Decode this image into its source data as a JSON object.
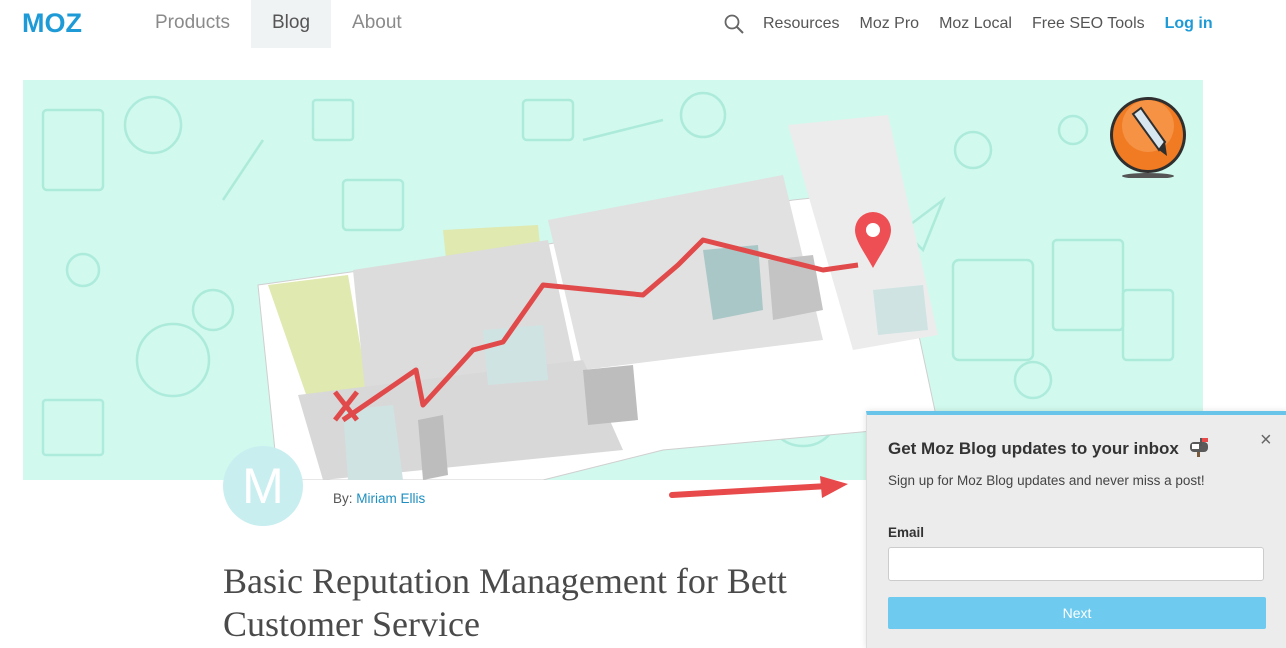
{
  "nav": {
    "logo_text": "MOZ",
    "left_items": [
      "Products",
      "Blog",
      "About"
    ],
    "right_items": [
      "Resources",
      "Moz Pro",
      "Moz Local",
      "Free SEO Tools"
    ],
    "login_label": "Log in"
  },
  "article": {
    "avatar_letter": "M",
    "by_label": "By:",
    "author": "Miriam Ellis",
    "title_line1": "Basic Reputation Management for Bett",
    "title_line2": "Customer Service"
  },
  "popup": {
    "heading": "Get Moz Blog updates to your inbox",
    "subheading": "Sign up for Moz Blog updates and never miss a post!",
    "email_label": "Email",
    "email_value": "",
    "next_label": "Next",
    "close_symbol": "×"
  },
  "colors": {
    "brand": "#1e9bd7",
    "hero_bg": "#d1f9ed",
    "route": "#e14a4a",
    "next_button": "#6ecbef"
  }
}
